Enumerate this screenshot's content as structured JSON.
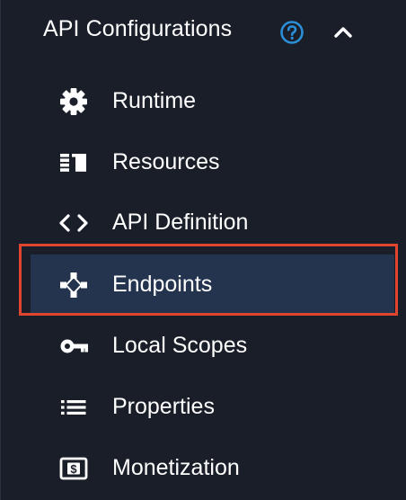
{
  "section": {
    "title": "API Configurations",
    "help_icon": "question-circle-icon",
    "collapse_icon": "chevron-up-icon"
  },
  "menu": {
    "items": [
      {
        "label": "Runtime",
        "icon": "gear-icon",
        "active": false
      },
      {
        "label": "Resources",
        "icon": "resources-icon",
        "active": false
      },
      {
        "label": "API Definition",
        "icon": "code-icon",
        "active": false
      },
      {
        "label": "Endpoints",
        "icon": "endpoints-icon",
        "active": true
      },
      {
        "label": "Local Scopes",
        "icon": "key-icon",
        "active": false
      },
      {
        "label": "Properties",
        "icon": "list-icon",
        "active": false
      },
      {
        "label": "Monetization",
        "icon": "dollar-icon",
        "active": false
      }
    ]
  },
  "colors": {
    "background": "#1a1e29",
    "active_background": "#24344f",
    "highlight_border": "#e0462f",
    "help_icon": "#2a8fd6",
    "text": "#ffffff"
  }
}
